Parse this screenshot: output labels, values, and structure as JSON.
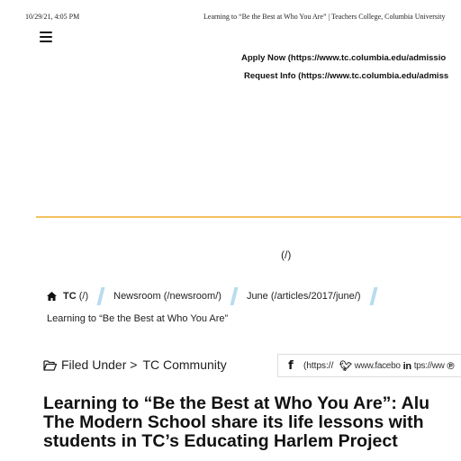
{
  "print_header": {
    "date": "10/29/21, 4:05 PM",
    "title": "Learning to “Be the Best at Who You Are” | Teachers College, Columbia University"
  },
  "nav": {
    "menu_icon": "hamburger-menu-icon",
    "apply_link": "Apply Now (https://www.tc.columbia.edu/admissio",
    "request_link": "Request Info (https://www.tc.columbia.edu/admiss",
    "home_link": "(/)"
  },
  "breadcrumb": {
    "home_icon": "house-icon",
    "tc_bold": "TC",
    "tc_href": " (/)",
    "newsroom": "Newsroom (/newsroom/)",
    "june": "June (/articles/2017/june/)",
    "current": "Learning to “Be the Best at Who You Are”"
  },
  "filed": {
    "icon": "folder-open-icon",
    "label": "Filed Under >",
    "category": "TC Community"
  },
  "share": {
    "facebook_icon": "facebook-icon",
    "facebook_text": "(https://",
    "overlap_text": "www.facebo",
    "twitter_icon": "twitter-icon",
    "linkedin_icon": "linkedin-icon",
    "pinterest_icon": "pinterest-icon",
    "tail_text": "tps://ww"
  },
  "article": {
    "title_line1": "Learning to “Be the Best at Who You Are”: Alu",
    "title_line2": "The Modern School share its life lessons with",
    "title_line3": "students in TC’s Educating Harlem Project"
  },
  "colors": {
    "gold_rule": "#f3c261",
    "slash_blue": "#b8dcef"
  }
}
